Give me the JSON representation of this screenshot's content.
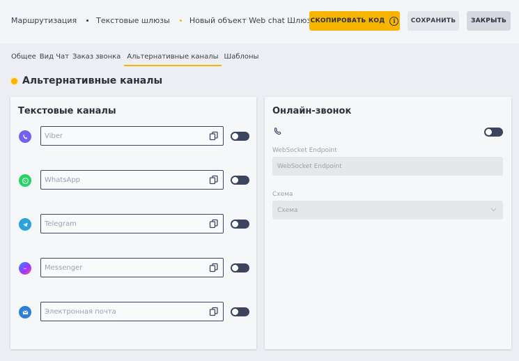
{
  "breadcrumb": {
    "items": [
      "Маршрутизация",
      "Текстовые шлюзы",
      "Новый объект Web chat Шлюз"
    ],
    "sep_colors": [
      "#2b2f3a",
      "#f7b500"
    ]
  },
  "toolbar": {
    "copy_code_label": "СКОПИРОВАТЬ КОД",
    "save_label": "СОХРАНИТЬ",
    "close_label": "ЗАКРЫТЬ",
    "accent_color": "#f7b500"
  },
  "tabs": [
    {
      "label": "Общее"
    },
    {
      "label": "Вид Чат"
    },
    {
      "label": "Заказ звонка"
    },
    {
      "label": "Альтернативные каналы",
      "active": true
    },
    {
      "label": "Шаблоны"
    }
  ],
  "section_title": "Альтернативные каналы",
  "text_channels": {
    "title": "Текстовые каналы",
    "items": [
      {
        "icon": "viber-icon",
        "placeholder": "Viber",
        "color": "#7360f2",
        "enabled": false
      },
      {
        "icon": "whatsapp-icon",
        "placeholder": "WhatsApp",
        "color": "#25d366",
        "enabled": false
      },
      {
        "icon": "telegram-icon",
        "placeholder": "Telegram",
        "color": "#2aa3dd",
        "enabled": false
      },
      {
        "icon": "messenger-icon",
        "placeholder": "Messenger",
        "color": "#7b52f5",
        "enabled": false
      },
      {
        "icon": "email-icon",
        "placeholder": "Электронная почта",
        "color": "#2b7fd8",
        "enabled": false
      }
    ]
  },
  "online_call": {
    "title": "Онлайн-звонок",
    "enabled": false,
    "endpoint_label": "WebSocket Endpoint",
    "endpoint_placeholder": "WebSocket Endpoint",
    "scheme_label": "Схема",
    "scheme_value": "Схема"
  }
}
